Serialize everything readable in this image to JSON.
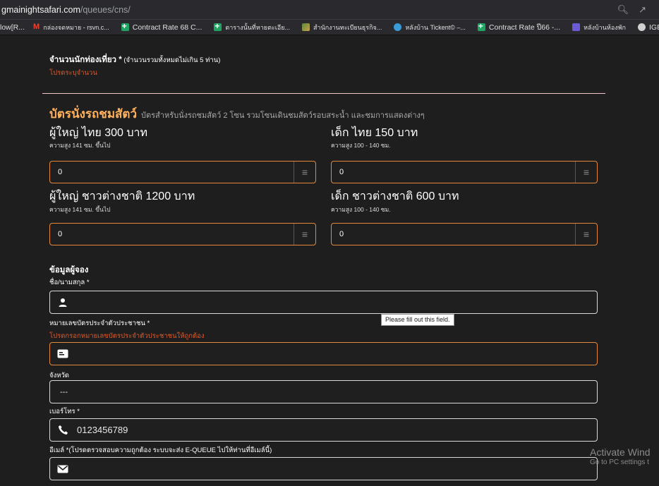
{
  "browser": {
    "url_host": "gmainightsafari.com",
    "url_path": "/queues/cns/",
    "bookmarks": [
      {
        "label": "low[R...",
        "icon": "none"
      },
      {
        "label": "กล่องจดหมาย - rsvn.c...",
        "icon": "gmail-icon"
      },
      {
        "label": "Contract Rate 68 C...",
        "icon": "sheets-icon"
      },
      {
        "label": "ตารางนั้นที่หายตะเอีย...",
        "icon": "sheets-icon"
      },
      {
        "label": "สำนักงานทะเบียนธุรกิจ...",
        "icon": "image-icon"
      },
      {
        "label": "หลังบ้าน Tickent© –...",
        "icon": "circle-icon"
      },
      {
        "label": "Contract Rate ปี66 -...",
        "icon": "sheets-icon"
      },
      {
        "label": "หลังบ้านห้องพัก",
        "icon": "purple-icon"
      },
      {
        "label": "IGENCO workflow",
        "icon": "globe-icon"
      }
    ]
  },
  "visitors": {
    "label": "จำนวนนักท่องเที่ยว",
    "required_mark": " *",
    "hint": " (จำนวนรวมทั้งหมดไม่เกิน 5 ท่าน)",
    "error": "โปรดระบุจำนวน"
  },
  "tram_section": {
    "title": "บัตรนั่งรถชมสัตว์",
    "description": "บัตรสำหรับนั่งรถชมสัตว์ 2 โซน รวมโซนเดินชมสัตว์รอบสระน้ำ และชมการแสดงต่างๆ",
    "tickets": [
      {
        "title": "ผู้ใหญ่ ไทย 300 บาท",
        "subtitle": "ความสูง 141 ซม. ขึ้นไป",
        "value": "0"
      },
      {
        "title": "เด็ก ไทย 150 บาท",
        "subtitle": "ความสูง 100 - 140 ซม.",
        "value": "0"
      },
      {
        "title": "ผู้ใหญ่ ชาวต่างชาติ 1200 บาท",
        "subtitle": "ความสูง 141 ซม. ขึ้นไป",
        "value": "0"
      },
      {
        "title": "เด็ก ชาวต่างชาติ 600 บาท",
        "subtitle": "ความสูง 100 - 140 ซม.",
        "value": "0"
      }
    ]
  },
  "booker": {
    "heading": "ข้อมูลผู้จอง",
    "name_label": "ชื่อ/นามสกุล *",
    "name_value": "",
    "id_label": "หมายเลขบัตรประจำตัวประชาชน *",
    "id_error": "โปรดกรอกหมายเลขบัตรประจำตัวประชาชนให้ถูกต้อง",
    "id_value": "",
    "province_label": "จังหวัด",
    "province_value": "---",
    "phone_label": "เบอร์โทร *",
    "phone_value": "0123456789",
    "email_label": "อีเมล์ *(โปรดตรวจสอบความถูกต้อง ระบบจะส่ง E-QUEUE ไปให้ท่านที่อีเมล์นี้)",
    "email_value": ""
  },
  "tooltip": "Please fill out this field.",
  "watermark": {
    "line1": "Activate Wind",
    "line2": "Go to PC settings t"
  },
  "colors": {
    "accent_orange": "#e38a3a",
    "section_title": "#ffb15c",
    "error": "#e05a2b",
    "background": "#1e1e1e"
  }
}
